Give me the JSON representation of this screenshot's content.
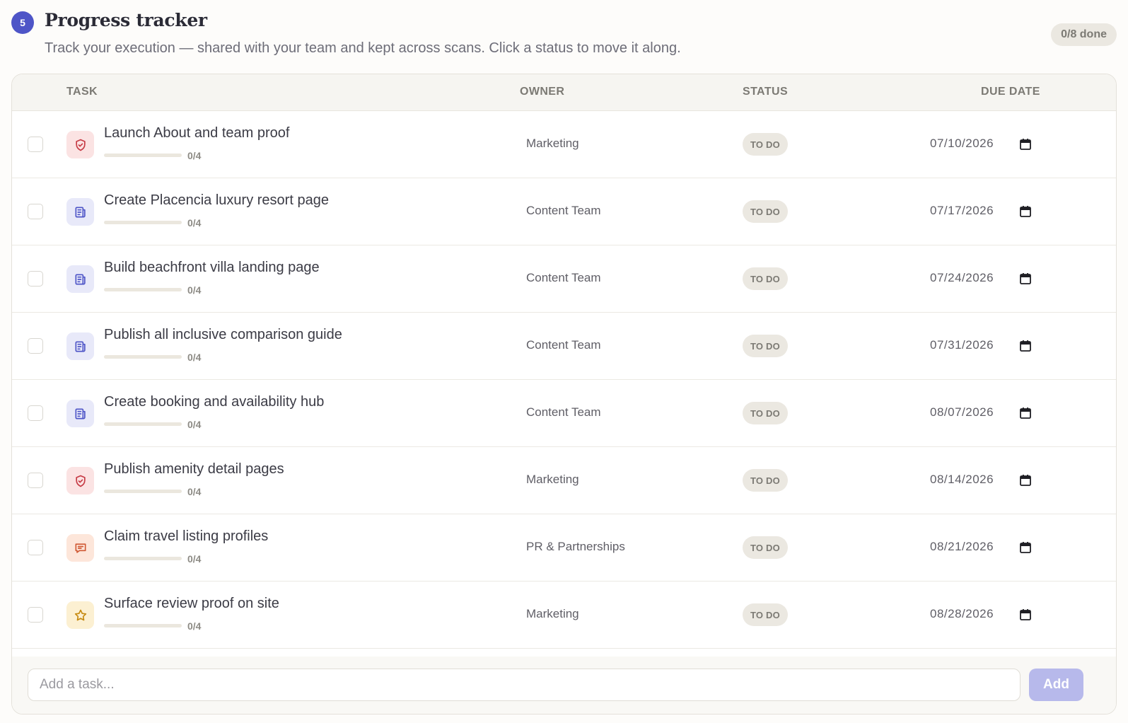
{
  "header": {
    "step": "5",
    "title": "Progress tracker",
    "subtitle": "Track your execution — shared with your team and kept across scans. Click a status to move it along.",
    "done_label": "0/8 done"
  },
  "table": {
    "columns": {
      "task": "TASK",
      "owner": "OWNER",
      "status": "STATUS",
      "due": "DUE DATE"
    },
    "rows": [
      {
        "task": "Launch About and team proof",
        "progress": "0/4",
        "progress_fraction": 0,
        "owner": "Marketing",
        "status": "TO DO",
        "due": "07/10/2026",
        "icon": "shield-icon",
        "icon_style": "shield"
      },
      {
        "task": "Create Placencia luxury resort page",
        "progress": "0/4",
        "progress_fraction": 0,
        "owner": "Content Team",
        "status": "TO DO",
        "due": "07/17/2026",
        "icon": "document-icon",
        "icon_style": "doc"
      },
      {
        "task": "Build beachfront villa landing page",
        "progress": "0/4",
        "progress_fraction": 0,
        "owner": "Content Team",
        "status": "TO DO",
        "due": "07/24/2026",
        "icon": "document-icon",
        "icon_style": "doc"
      },
      {
        "task": "Publish all inclusive comparison guide",
        "progress": "0/4",
        "progress_fraction": 0,
        "owner": "Content Team",
        "status": "TO DO",
        "due": "07/31/2026",
        "icon": "document-icon",
        "icon_style": "doc"
      },
      {
        "task": "Create booking and availability hub",
        "progress": "0/4",
        "progress_fraction": 0,
        "owner": "Content Team",
        "status": "TO DO",
        "due": "08/07/2026",
        "icon": "document-icon",
        "icon_style": "doc"
      },
      {
        "task": "Publish amenity detail pages",
        "progress": "0/4",
        "progress_fraction": 0,
        "owner": "Marketing",
        "status": "TO DO",
        "due": "08/14/2026",
        "icon": "shield-icon",
        "icon_style": "shield"
      },
      {
        "task": "Claim travel listing profiles",
        "progress": "0/4",
        "progress_fraction": 0,
        "owner": "PR & Partnerships",
        "status": "TO DO",
        "due": "08/21/2026",
        "icon": "chat-icon",
        "icon_style": "chat"
      },
      {
        "task": "Surface review proof on site",
        "progress": "0/4",
        "progress_fraction": 0,
        "owner": "Marketing",
        "status": "TO DO",
        "due": "08/28/2026",
        "icon": "star-icon",
        "icon_style": "star"
      }
    ]
  },
  "footer": {
    "input_placeholder": "Add a task...",
    "input_value": "",
    "add_label": "Add"
  },
  "colors": {
    "accent": "#4e55c7",
    "add_button": "#b7b9eb",
    "status_pill": "#ebe8e1"
  }
}
